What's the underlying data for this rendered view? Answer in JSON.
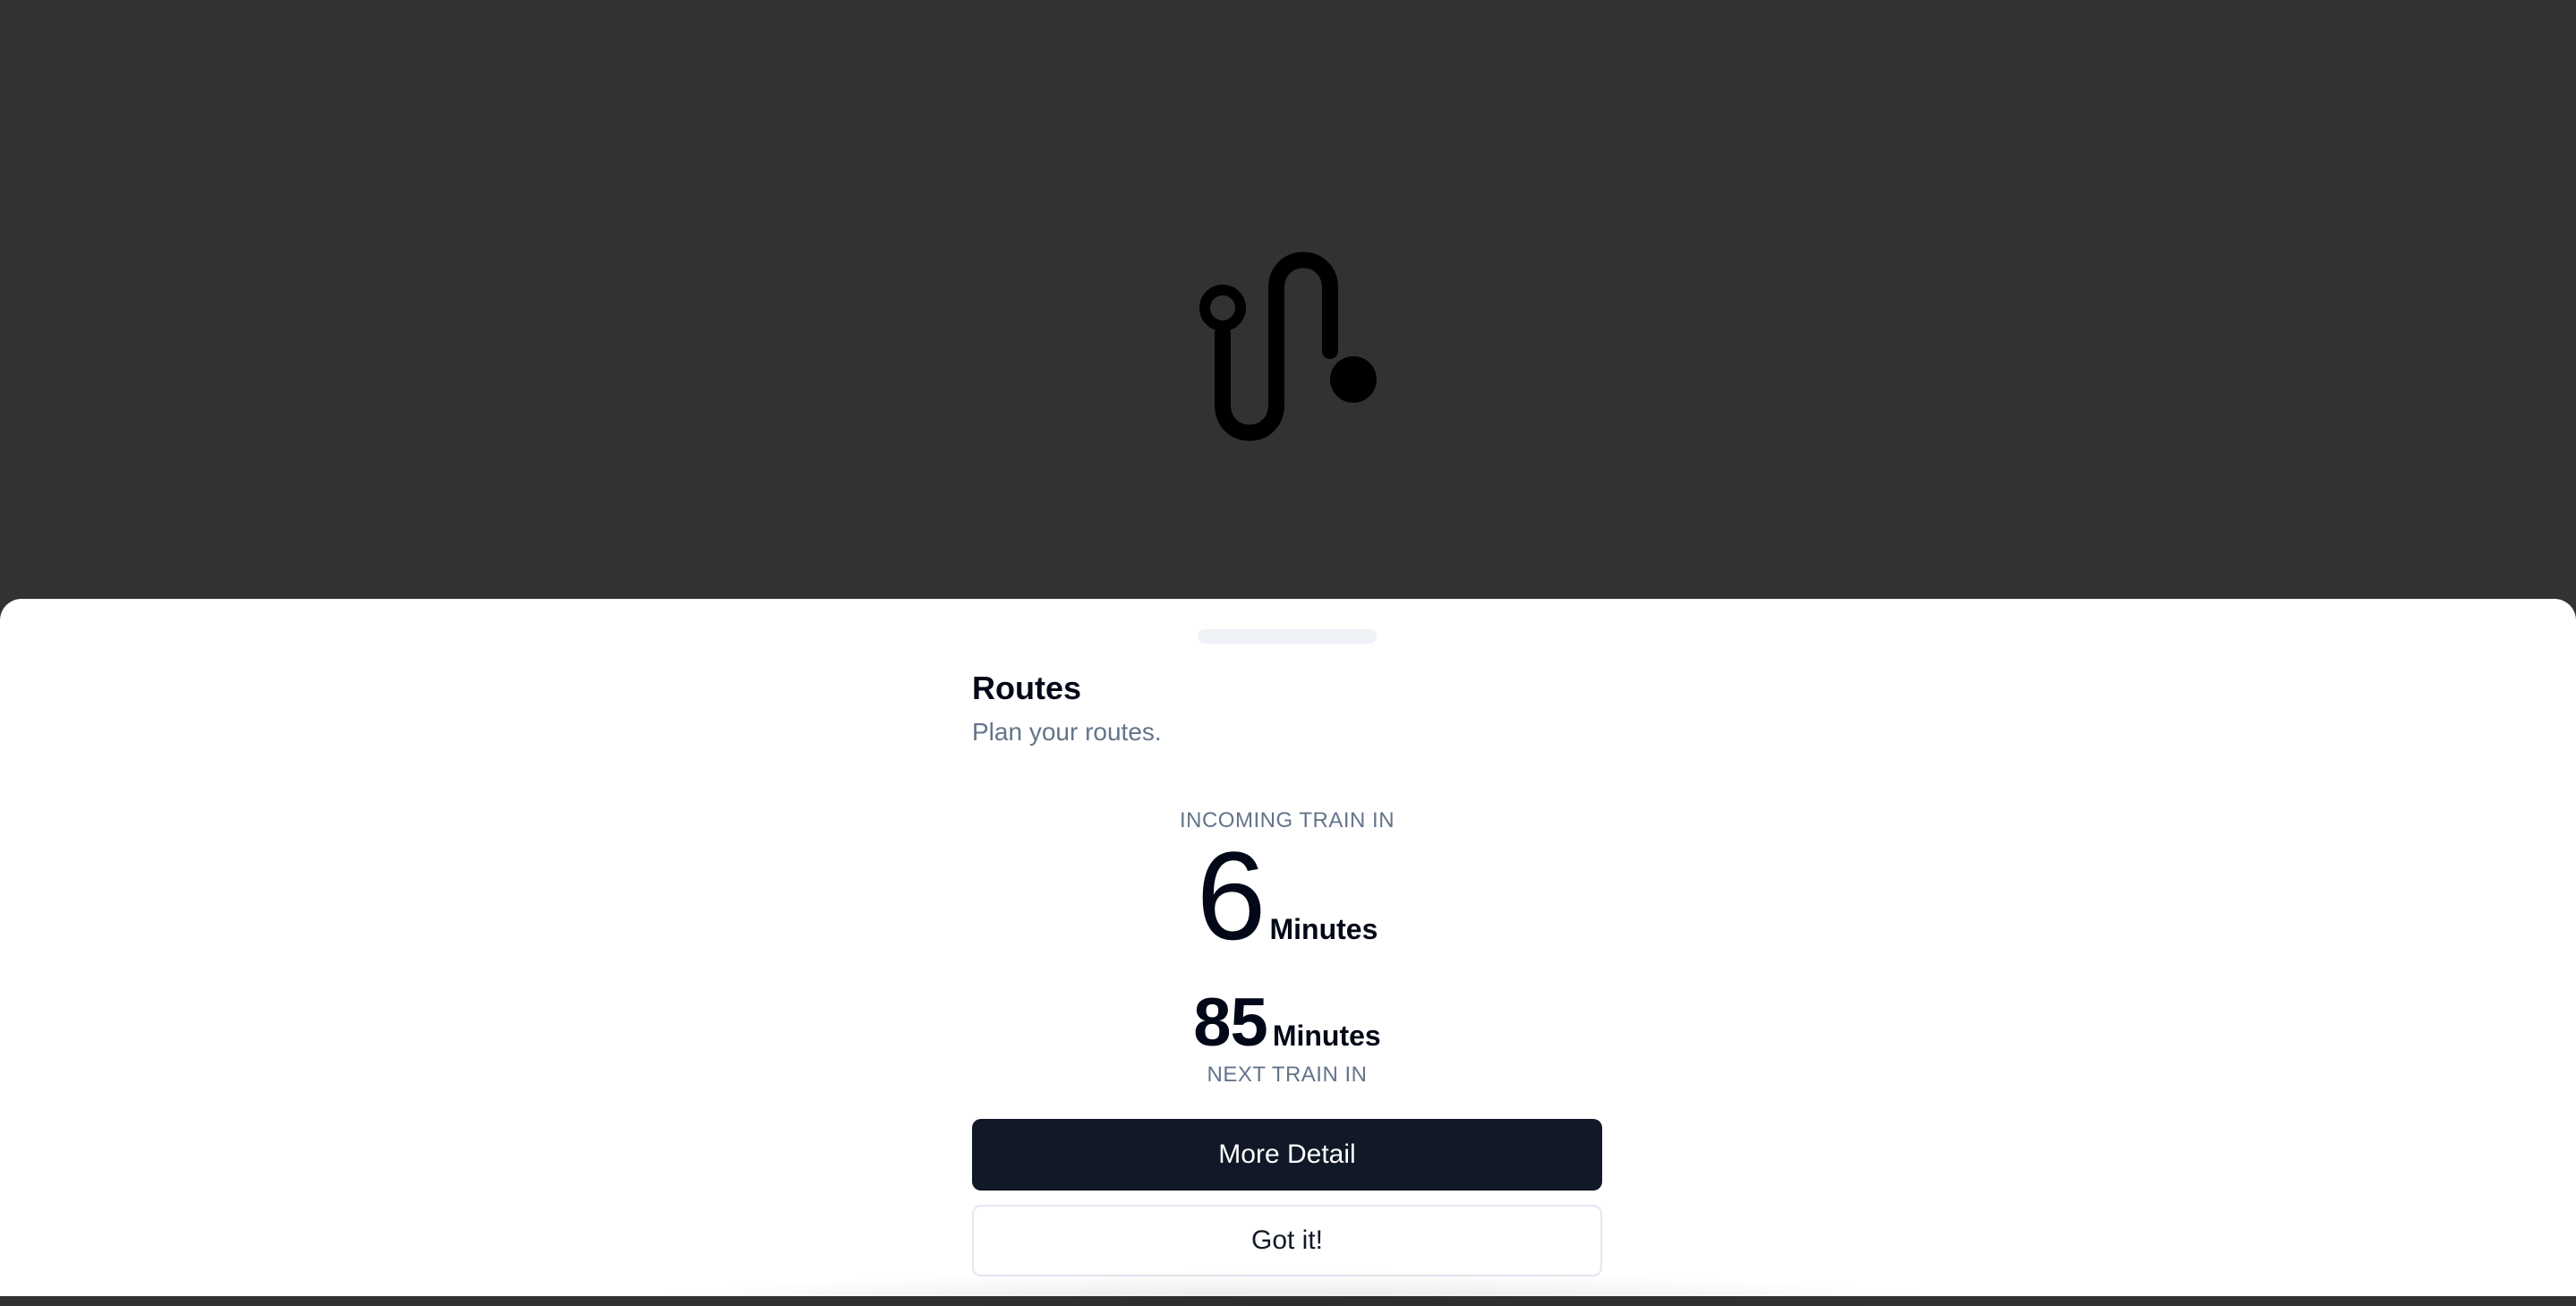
{
  "sheet": {
    "title": "Routes",
    "subtitle": "Plan your routes."
  },
  "incoming": {
    "label": "INCOMING TRAIN IN",
    "value": "6",
    "unit": "Minutes"
  },
  "next": {
    "value": "85",
    "unit": "Minutes",
    "label": "NEXT TRAIN IN"
  },
  "actions": {
    "primary_label": "More Detail",
    "secondary_label": "Got it!"
  },
  "icons": {
    "logo": "app-logo-icon"
  },
  "colors": {
    "backdrop": "#323232",
    "sheet": "#ffffff",
    "primary_button": "#111827",
    "muted_text": "#64748b",
    "text": "#020817"
  }
}
